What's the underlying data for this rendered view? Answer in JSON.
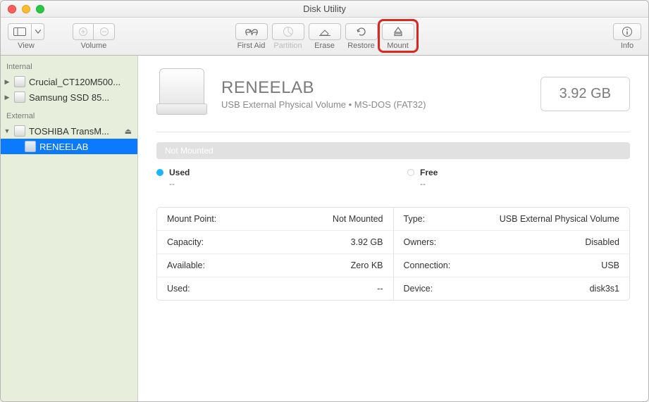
{
  "window": {
    "title": "Disk Utility"
  },
  "toolbar": {
    "view": "View",
    "volume": "Volume",
    "firstaid": "First Aid",
    "partition": "Partition",
    "erase": "Erase",
    "restore": "Restore",
    "mount": "Mount",
    "info": "Info"
  },
  "sidebar": {
    "internal_header": "Internal",
    "internal": [
      {
        "label": "Crucial_CT120M500..."
      },
      {
        "label": "Samsung SSD 85..."
      }
    ],
    "external_header": "External",
    "external": [
      {
        "label": "TOSHIBA TransM...",
        "ejectable": true,
        "children": [
          "RENEELAB"
        ]
      }
    ]
  },
  "volume": {
    "name": "RENEELAB",
    "subtitle": "USB External Physical Volume • MS-DOS (FAT32)",
    "size": "3.92 GB",
    "status": "Not Mounted",
    "used_label": "Used",
    "used_value": "--",
    "free_label": "Free",
    "free_value": "--"
  },
  "props_left": {
    "mountpoint_k": "Mount Point:",
    "mountpoint_v": "Not Mounted",
    "capacity_k": "Capacity:",
    "capacity_v": "3.92 GB",
    "available_k": "Available:",
    "available_v": "Zero KB",
    "used_k": "Used:",
    "used_v": "--"
  },
  "props_right": {
    "type_k": "Type:",
    "type_v": "USB External Physical Volume",
    "owners_k": "Owners:",
    "owners_v": "Disabled",
    "connection_k": "Connection:",
    "connection_v": "USB",
    "device_k": "Device:",
    "device_v": "disk3s1"
  }
}
